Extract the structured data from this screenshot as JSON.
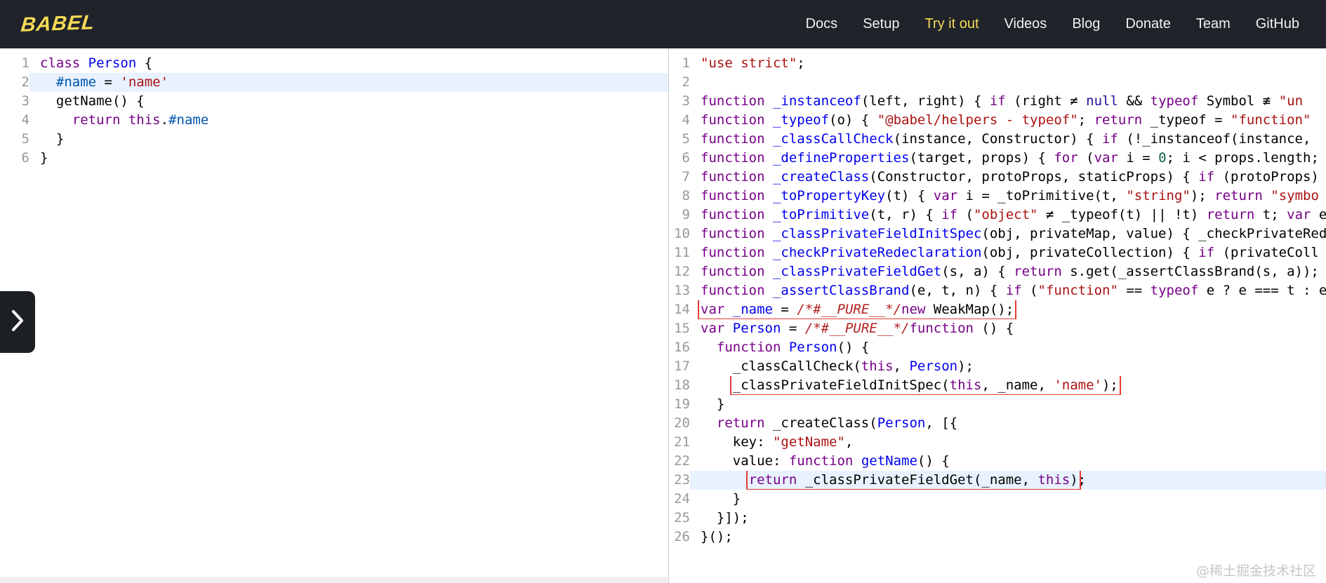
{
  "header": {
    "logo": "BABEL",
    "nav": [
      {
        "label": "Docs",
        "active": false
      },
      {
        "label": "Setup",
        "active": false
      },
      {
        "label": "Try it out",
        "active": true
      },
      {
        "label": "Videos",
        "active": false
      },
      {
        "label": "Blog",
        "active": false
      },
      {
        "label": "Donate",
        "active": false
      },
      {
        "label": "Team",
        "active": false
      },
      {
        "label": "GitHub",
        "active": false
      }
    ]
  },
  "colors": {
    "header_bg": "#20232a",
    "brand_yellow": "#f5da55",
    "keyword": "#770088",
    "definition": "#0000ee",
    "string": "#aa1111",
    "number": "#116644",
    "comment": "#b22222",
    "property": "#0055aa",
    "atom": "#221199",
    "gutter_text": "#999999",
    "line_highlight": "#e8f2ff",
    "mapping_box_red": "#e53935"
  },
  "source_editor": {
    "lines": [
      {
        "n": 1,
        "t": [
          [
            "k",
            "class"
          ],
          [
            "p",
            " "
          ],
          [
            "d",
            "Person"
          ],
          [
            "p",
            " {"
          ]
        ]
      },
      {
        "n": 2,
        "hl": true,
        "t": [
          [
            "p",
            "  "
          ],
          [
            "pr",
            "#name"
          ],
          [
            "p",
            " = "
          ],
          [
            "s",
            "'name'"
          ]
        ]
      },
      {
        "n": 3,
        "t": [
          [
            "p",
            "  getName() {"
          ]
        ]
      },
      {
        "n": 4,
        "t": [
          [
            "p",
            "    "
          ],
          [
            "k",
            "return"
          ],
          [
            "p",
            " "
          ],
          [
            "k",
            "this"
          ],
          [
            "p",
            "."
          ],
          [
            "pr",
            "#name"
          ]
        ]
      },
      {
        "n": 5,
        "t": [
          [
            "p",
            "  }"
          ]
        ]
      },
      {
        "n": 6,
        "t": [
          [
            "p",
            "}"
          ]
        ]
      }
    ]
  },
  "output_editor": {
    "lines": [
      {
        "n": 1,
        "t": [
          [
            "s",
            "\"use strict\""
          ],
          [
            "p",
            ";"
          ]
        ]
      },
      {
        "n": 2,
        "t": []
      },
      {
        "n": 3,
        "t": [
          [
            "k",
            "function"
          ],
          [
            "p",
            " "
          ],
          [
            "d",
            "_instanceof"
          ],
          [
            "p",
            "(left, right) { "
          ],
          [
            "k",
            "if"
          ],
          [
            "p",
            " (right ≠ "
          ],
          [
            "a",
            "null"
          ],
          [
            "p",
            " && "
          ],
          [
            "k",
            "typeof"
          ],
          [
            "p",
            " Symbol ≢ "
          ],
          [
            "s",
            "\"un"
          ]
        ]
      },
      {
        "n": 4,
        "t": [
          [
            "k",
            "function"
          ],
          [
            "p",
            " "
          ],
          [
            "d",
            "_typeof"
          ],
          [
            "p",
            "(o) { "
          ],
          [
            "s",
            "\"@babel/helpers - typeof\""
          ],
          [
            "p",
            "; "
          ],
          [
            "k",
            "return"
          ],
          [
            "p",
            " _typeof = "
          ],
          [
            "s",
            "\"function\""
          ]
        ]
      },
      {
        "n": 5,
        "t": [
          [
            "k",
            "function"
          ],
          [
            "p",
            " "
          ],
          [
            "d",
            "_classCallCheck"
          ],
          [
            "p",
            "(instance, Constructor) { "
          ],
          [
            "k",
            "if"
          ],
          [
            "p",
            " (!_instanceof(instance, "
          ]
        ]
      },
      {
        "n": 6,
        "t": [
          [
            "k",
            "function"
          ],
          [
            "p",
            " "
          ],
          [
            "d",
            "_defineProperties"
          ],
          [
            "p",
            "(target, props) { "
          ],
          [
            "k",
            "for"
          ],
          [
            "p",
            " ("
          ],
          [
            "k",
            "var"
          ],
          [
            "p",
            " i = "
          ],
          [
            "n",
            "0"
          ],
          [
            "p",
            "; i < props.length;"
          ]
        ]
      },
      {
        "n": 7,
        "t": [
          [
            "k",
            "function"
          ],
          [
            "p",
            " "
          ],
          [
            "d",
            "_createClass"
          ],
          [
            "p",
            "(Constructor, protoProps, staticProps) { "
          ],
          [
            "k",
            "if"
          ],
          [
            "p",
            " (protoProps) "
          ]
        ]
      },
      {
        "n": 8,
        "t": [
          [
            "k",
            "function"
          ],
          [
            "p",
            " "
          ],
          [
            "d",
            "_toPropertyKey"
          ],
          [
            "p",
            "(t) { "
          ],
          [
            "k",
            "var"
          ],
          [
            "p",
            " i = _toPrimitive(t, "
          ],
          [
            "s",
            "\"string\""
          ],
          [
            "p",
            "); "
          ],
          [
            "k",
            "return"
          ],
          [
            "p",
            " "
          ],
          [
            "s",
            "\"symbo"
          ]
        ]
      },
      {
        "n": 9,
        "t": [
          [
            "k",
            "function"
          ],
          [
            "p",
            " "
          ],
          [
            "d",
            "_toPrimitive"
          ],
          [
            "p",
            "(t, r) { "
          ],
          [
            "k",
            "if"
          ],
          [
            "p",
            " ("
          ],
          [
            "s",
            "\"object\""
          ],
          [
            "p",
            " ≠ _typeof(t) || !t) "
          ],
          [
            "k",
            "return"
          ],
          [
            "p",
            " t; "
          ],
          [
            "k",
            "var"
          ],
          [
            "p",
            " e"
          ]
        ]
      },
      {
        "n": 10,
        "t": [
          [
            "k",
            "function"
          ],
          [
            "p",
            " "
          ],
          [
            "d",
            "_classPrivateFieldInitSpec"
          ],
          [
            "p",
            "(obj, privateMap, value) { _checkPrivateRed"
          ]
        ]
      },
      {
        "n": 11,
        "t": [
          [
            "k",
            "function"
          ],
          [
            "p",
            " "
          ],
          [
            "d",
            "_checkPrivateRedeclaration"
          ],
          [
            "p",
            "(obj, privateCollection) { "
          ],
          [
            "k",
            "if"
          ],
          [
            "p",
            " (privateColl"
          ]
        ]
      },
      {
        "n": 12,
        "t": [
          [
            "k",
            "function"
          ],
          [
            "p",
            " "
          ],
          [
            "d",
            "_classPrivateFieldGet"
          ],
          [
            "p",
            "(s, a) { "
          ],
          [
            "k",
            "return"
          ],
          [
            "p",
            " s.get(_assertClassBrand(s, a));"
          ]
        ]
      },
      {
        "n": 13,
        "t": [
          [
            "k",
            "function"
          ],
          [
            "p",
            " "
          ],
          [
            "d",
            "_assertClassBrand"
          ],
          [
            "p",
            "(e, t, n) { "
          ],
          [
            "k",
            "if"
          ],
          [
            "p",
            " ("
          ],
          [
            "s",
            "\"function\""
          ],
          [
            "p",
            " == "
          ],
          [
            "k",
            "typeof"
          ],
          [
            "p",
            " e ? e === t : e"
          ]
        ]
      },
      {
        "n": 14,
        "box": [
          0,
          7
        ],
        "t": [
          [
            "k",
            "var"
          ],
          [
            "p",
            " "
          ],
          [
            "d",
            "_name"
          ],
          [
            "p",
            " = "
          ],
          [
            "c",
            "/*#__PURE__*/"
          ],
          [
            "k",
            "new"
          ],
          [
            "p",
            " WeakMap();"
          ]
        ]
      },
      {
        "n": 15,
        "t": [
          [
            "k",
            "var"
          ],
          [
            "p",
            " "
          ],
          [
            "d",
            "Person"
          ],
          [
            "p",
            " = "
          ],
          [
            "c",
            "/*#__PURE__*/"
          ],
          [
            "k",
            "function"
          ],
          [
            "p",
            " () {"
          ]
        ]
      },
      {
        "n": 16,
        "t": [
          [
            "p",
            "  "
          ],
          [
            "k",
            "function"
          ],
          [
            "p",
            " "
          ],
          [
            "d",
            "Person"
          ],
          [
            "p",
            "() {"
          ]
        ]
      },
      {
        "n": 17,
        "t": [
          [
            "p",
            "    _classCallCheck("
          ],
          [
            "k",
            "this"
          ],
          [
            "p",
            ", "
          ],
          [
            "d",
            "Person"
          ],
          [
            "p",
            ");"
          ]
        ]
      },
      {
        "n": 18,
        "box": [
          1,
          6
        ],
        "t": [
          [
            "p",
            "    "
          ],
          [
            "p",
            "_classPrivateFieldInitSpec("
          ],
          [
            "k",
            "this"
          ],
          [
            "p",
            ", _name, "
          ],
          [
            "s",
            "'name'"
          ],
          [
            "p",
            ");"
          ]
        ]
      },
      {
        "n": 19,
        "t": [
          [
            "p",
            "  }"
          ]
        ]
      },
      {
        "n": 20,
        "t": [
          [
            "p",
            "  "
          ],
          [
            "k",
            "return"
          ],
          [
            "p",
            " _createClass("
          ],
          [
            "d",
            "Person"
          ],
          [
            "p",
            ", [{"
          ]
        ]
      },
      {
        "n": 21,
        "t": [
          [
            "p",
            "    key: "
          ],
          [
            "s",
            "\"getName\""
          ],
          [
            "p",
            ","
          ]
        ]
      },
      {
        "n": 22,
        "t": [
          [
            "p",
            "    value: "
          ],
          [
            "k",
            "function"
          ],
          [
            "p",
            " "
          ],
          [
            "d",
            "getName"
          ],
          [
            "p",
            "() {"
          ]
        ]
      },
      {
        "n": 23,
        "hl": true,
        "box": [
          1,
          5
        ],
        "t": [
          [
            "p",
            "      "
          ],
          [
            "k",
            "return"
          ],
          [
            "p",
            " _classPrivateFieldGet(_name, "
          ],
          [
            "k",
            "this"
          ],
          [
            "p",
            ")"
          ],
          [
            "p",
            ";"
          ]
        ]
      },
      {
        "n": 24,
        "t": [
          [
            "p",
            "    }"
          ]
        ]
      },
      {
        "n": 25,
        "t": [
          [
            "p",
            "  }]);"
          ]
        ]
      },
      {
        "n": 26,
        "t": [
          [
            "p",
            "}();"
          ]
        ]
      }
    ]
  },
  "watermark": "@稀土掘金技术社区"
}
